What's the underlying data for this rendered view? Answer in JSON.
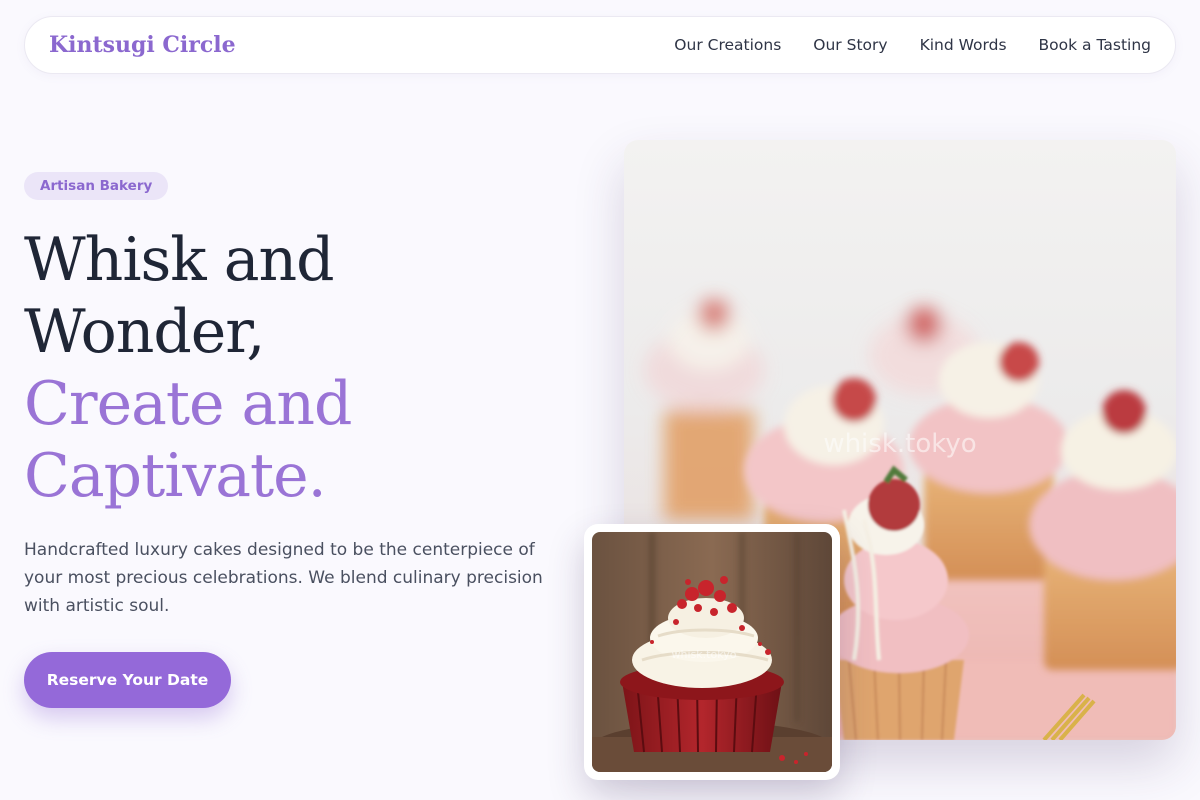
{
  "brand": "Kintsugi Circle",
  "nav": {
    "links": [
      "Our Creations",
      "Our Story",
      "Kind Words",
      "Book a Tasting"
    ]
  },
  "hero": {
    "badge": "Artisan Bakery",
    "headline_dark_1": "Whisk and",
    "headline_dark_2": "Wonder,",
    "headline_accent_1": "Create and",
    "headline_accent_2": "Captivate.",
    "lead": "Handcrafted luxury cakes designed to be the centerpiece of your most precious celebrations. We blend culinary precision with artistic soul.",
    "cta": "Reserve Your Date",
    "main_image_watermark": "whisk.tokyo",
    "inset_image_watermark": "whisk.tokyo"
  },
  "colors": {
    "accent": "#9469d9",
    "brand": "#8b68cf",
    "heading": "#1f2636",
    "background": "#faf9fe",
    "badge_bg": "#ebe5f8"
  },
  "icons": {
    "main_image": "cupcakes-photo",
    "inset_image": "red-velvet-cupcake-photo"
  }
}
